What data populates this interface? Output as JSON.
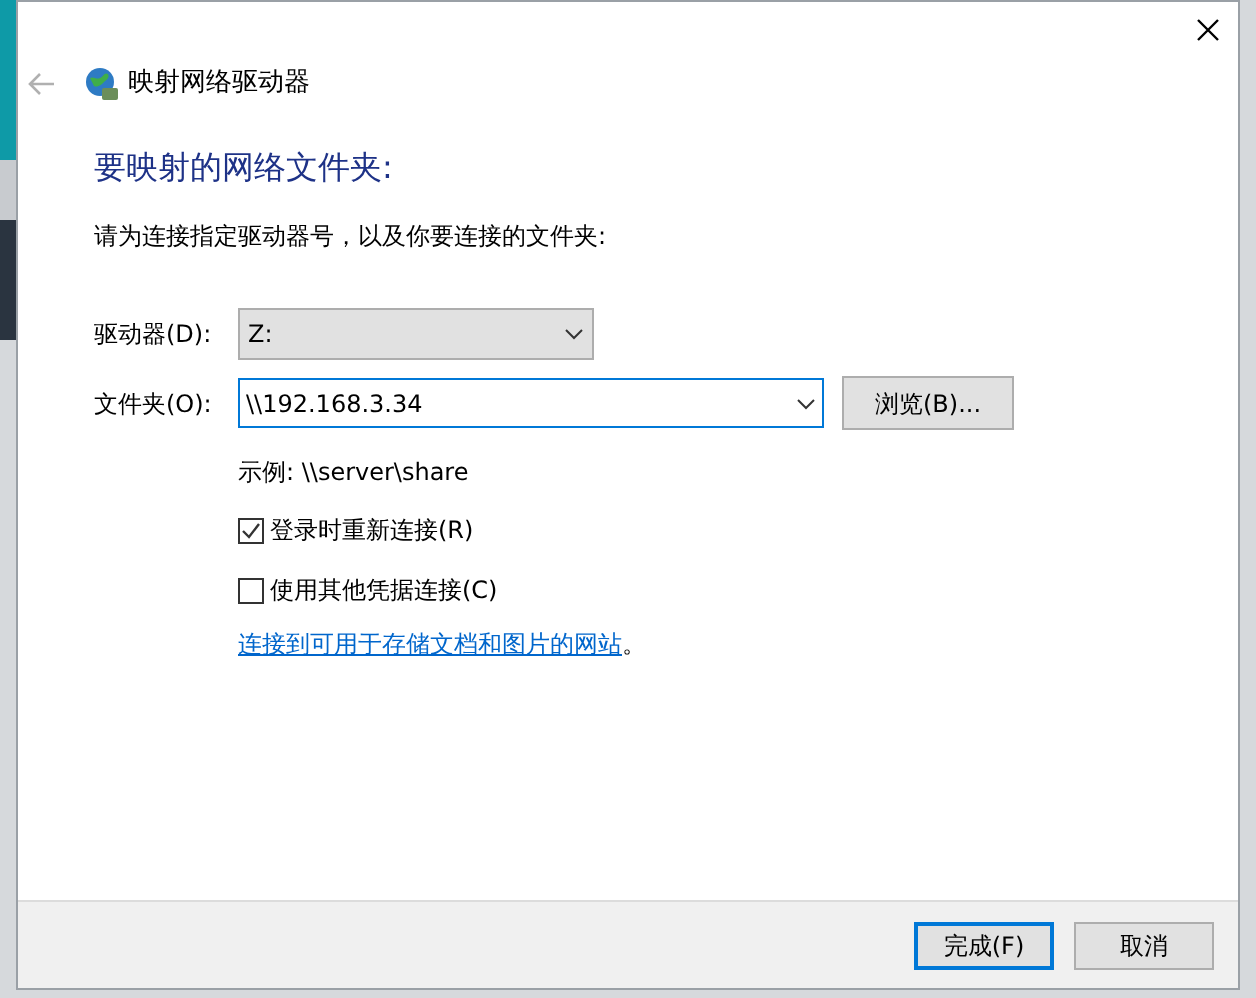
{
  "window": {
    "title": "映射网络驱动器"
  },
  "heading": "要映射的网络文件夹:",
  "instruction": "请为连接指定驱动器号，以及你要连接的文件夹:",
  "drive": {
    "label": "驱动器(D):",
    "value": "Z:"
  },
  "folder": {
    "label": "文件夹(O):",
    "value": "\\\\192.168.3.34",
    "browse_button": "浏览(B)..."
  },
  "example": "示例: \\\\server\\share",
  "options": [
    {
      "label": "登录时重新连接(R)",
      "checked": true
    },
    {
      "label": "使用其他凭据连接(C)",
      "checked": false
    }
  ],
  "link": {
    "text": "连接到可用于存储文档和图片的网站",
    "suffix": "。"
  },
  "buttons": [
    {
      "label": "完成(F)",
      "default": true
    },
    {
      "label": "取消",
      "default": false
    }
  ]
}
